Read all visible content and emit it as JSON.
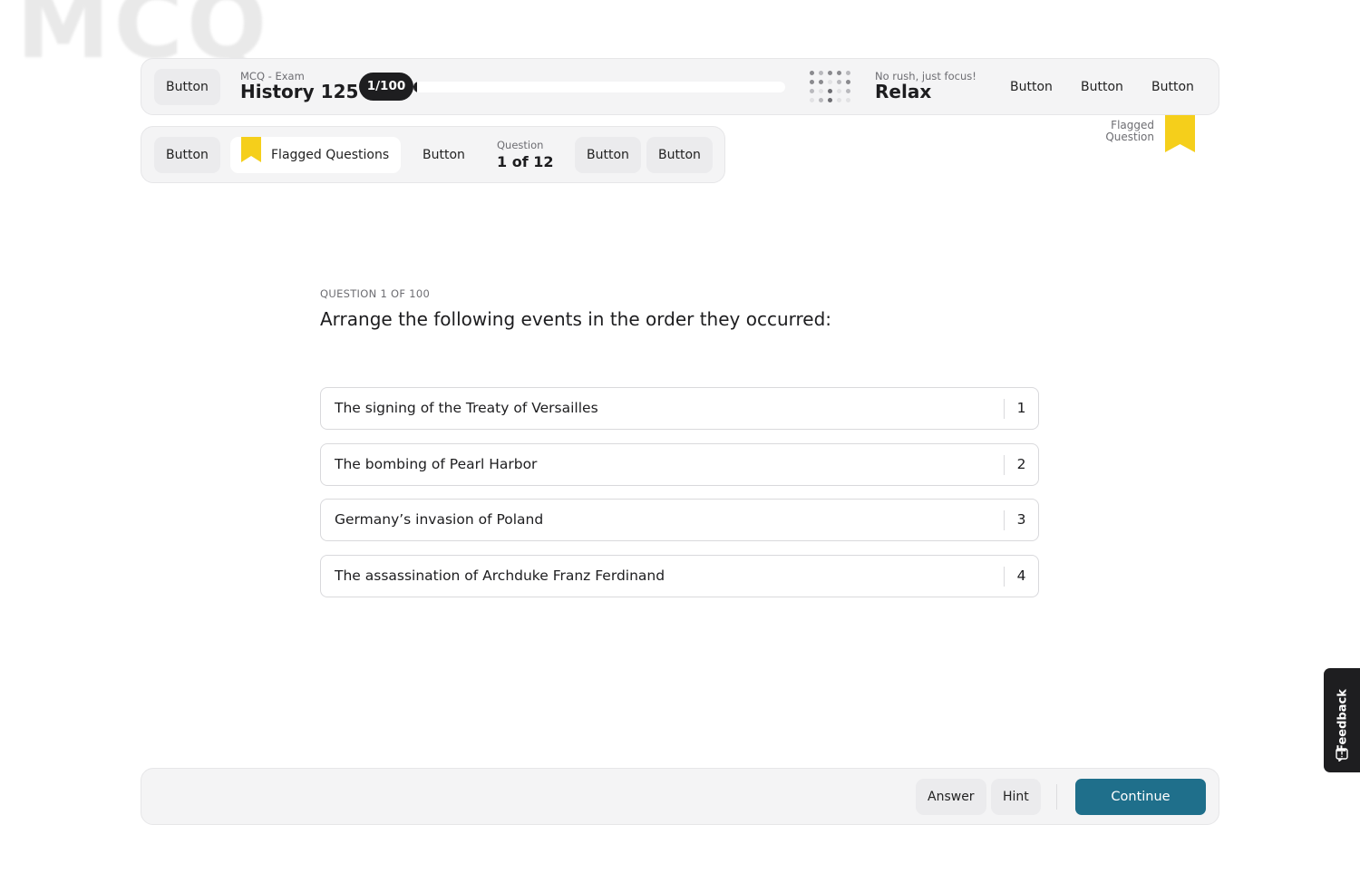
{
  "watermark": "MCQ",
  "top_bar": {
    "left_button": "Button",
    "exam_type": "MCQ - Exam",
    "exam_title": "History 125",
    "counter": "1/100",
    "progress_fraction": 0.01,
    "mood_caption": "No rush, just focus!",
    "mood_title": "Relax",
    "right_buttons": [
      "Button",
      "Button",
      "Button"
    ]
  },
  "sub_bar": {
    "left_button": "Button",
    "flagged_label": "Flagged Questions",
    "mid_button": "Button",
    "question_caption": "Question",
    "question_position": "1 of 12",
    "right_buttons": [
      "Button",
      "Button"
    ]
  },
  "flag_legend": {
    "label": "Flagged Question"
  },
  "question": {
    "eyebrow": "QUESTION 1 OF 100",
    "text": "Arrange the following events in the order they occurred:",
    "options": [
      {
        "text": "The signing of the Treaty of Versailles",
        "number": "1"
      },
      {
        "text": "The bombing of Pearl Harbor",
        "number": "2"
      },
      {
        "text": "Germany’s invasion of Poland",
        "number": "3"
      },
      {
        "text": "The assassination of Archduke Franz Ferdinand",
        "number": "4"
      }
    ]
  },
  "footer": {
    "answer_label": "Answer",
    "hint_label": "Hint",
    "continue_label": "Continue"
  },
  "feedback_tab": {
    "label": "Feedback"
  },
  "colors": {
    "accent": "#1f6f8b",
    "flag": "#f5cf1b",
    "dark": "#1e1e20",
    "panel": "#f4f4f5"
  },
  "icons": {
    "flag": "bookmark-flag-icon",
    "dots": "dot-matrix-icon",
    "feedback": "feedback-chat-icon"
  }
}
